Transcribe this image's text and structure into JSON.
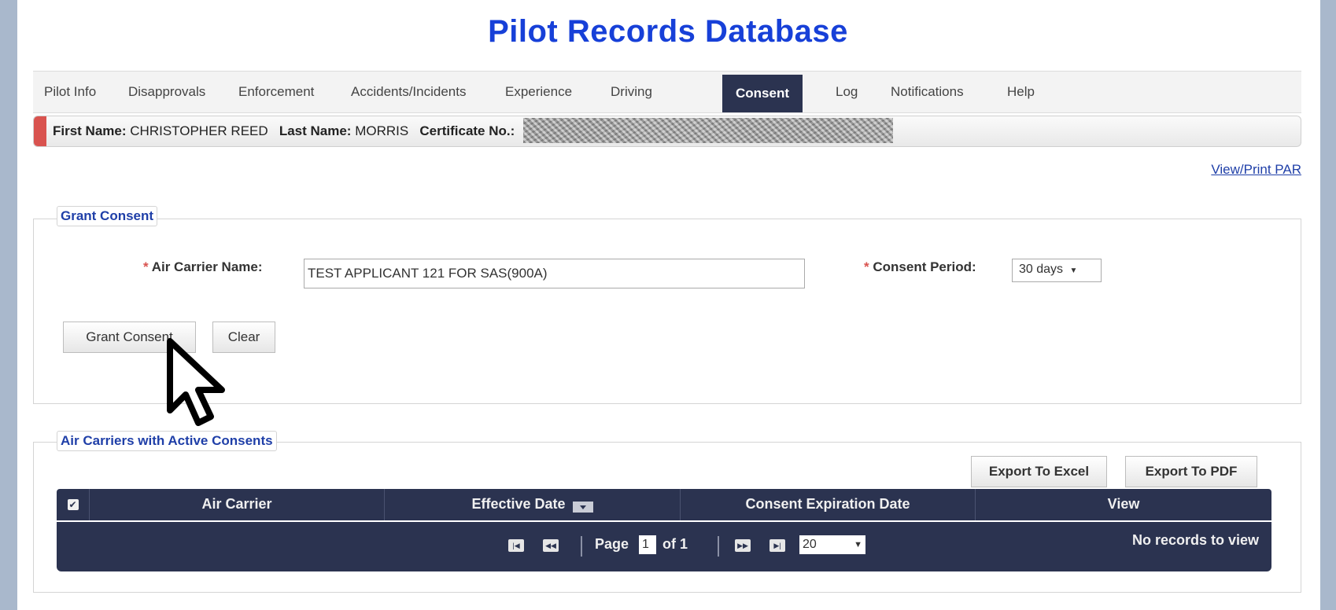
{
  "header": {
    "title": "Pilot Records Database"
  },
  "nav": {
    "items": [
      {
        "label": "Pilot Info"
      },
      {
        "label": "Disapprovals"
      },
      {
        "label": "Enforcement"
      },
      {
        "label": "Accidents/Incidents"
      },
      {
        "label": "Experience"
      },
      {
        "label": "Driving"
      },
      {
        "label": "Consent",
        "active": true
      },
      {
        "label": "Log"
      },
      {
        "label": "Notifications"
      },
      {
        "label": "Help"
      }
    ]
  },
  "pilot": {
    "first_name_label": "First Name:",
    "first_name": "CHRISTOPHER REED",
    "last_name_label": "Last Name:",
    "last_name": "MORRIS",
    "certificate_label": "Certificate No.:"
  },
  "links": {
    "view_print": "View/Print PAR"
  },
  "grant_consent": {
    "legend": "Grant Consent",
    "required_mark": "*",
    "air_carrier_label": "Air Carrier Name:",
    "air_carrier_value": "TEST APPLICANT 121 FOR SAS(900A)",
    "consent_period_label": "Consent Period:",
    "consent_period_value": "30 days",
    "grant_button": "Grant Consent",
    "clear_button": "Clear"
  },
  "active_consents": {
    "legend": "Air Carriers with Active Consents",
    "export_excel": "Export To Excel",
    "export_pdf": "Export To PDF",
    "columns": [
      "Air Carrier",
      "Effective Date",
      "Consent Expiration Date",
      "View"
    ],
    "pager": {
      "page_label": "Page",
      "page_value": "1",
      "of_label": "of 1",
      "page_size": "20",
      "empty_message": "No records to view"
    }
  },
  "colors": {
    "title": "#1740d8",
    "grid_header": "#2b3350",
    "legend_text": "#1f3fa8",
    "required": "#d9534f"
  }
}
